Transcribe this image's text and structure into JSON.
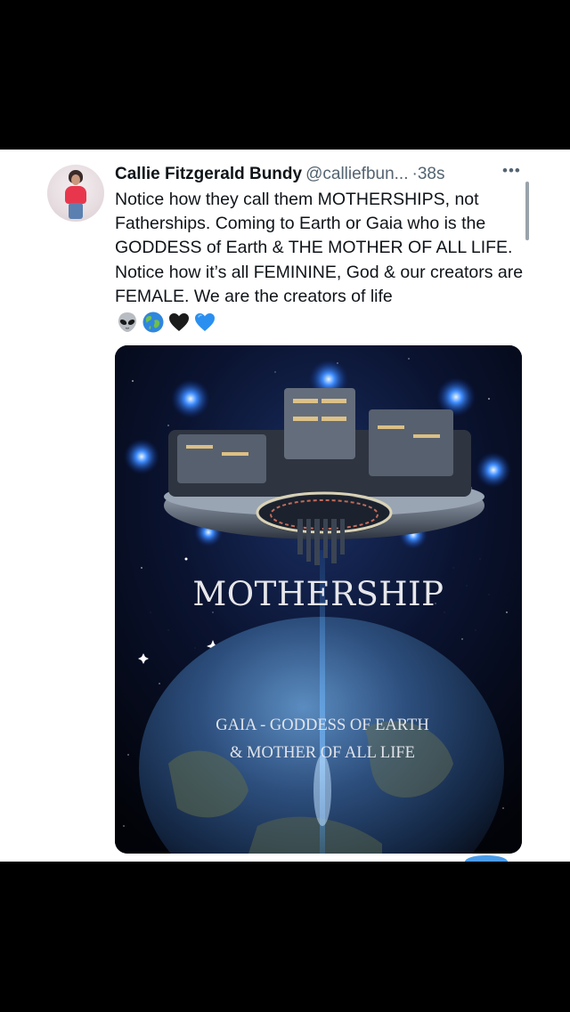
{
  "tweet": {
    "author_name": "Callie Fitzgerald Bundy",
    "author_handle": "@calliefbun...",
    "separator": "·",
    "timestamp": "38s",
    "text": "Notice how they call them MOTHERSHIPS, not Fatherships. Coming to Earth or Gaia who is the GODDESS of Earth & THE MOTHER OF ALL LIFE. Notice how it’s all FEMININE, God & our creators are FEMALE. We are the creators of life",
    "emojis": [
      "alien-emoji",
      "earth-globe-emoji",
      "black-heart-emoji",
      "blue-heart-emoji"
    ],
    "more_icon": "more-horizontal-icon",
    "media": {
      "title": "MOTHERSHIP",
      "subtitle_line1": "GAIA - GODDESS OF EARTH",
      "subtitle_line2": "& MOTHER OF ALL LIFE"
    }
  },
  "colors": {
    "page_background": "#000000",
    "card_background": "#ffffff",
    "text_primary": "#0f1419",
    "text_secondary": "#536471",
    "accent_blue": "#1d9bf0"
  }
}
